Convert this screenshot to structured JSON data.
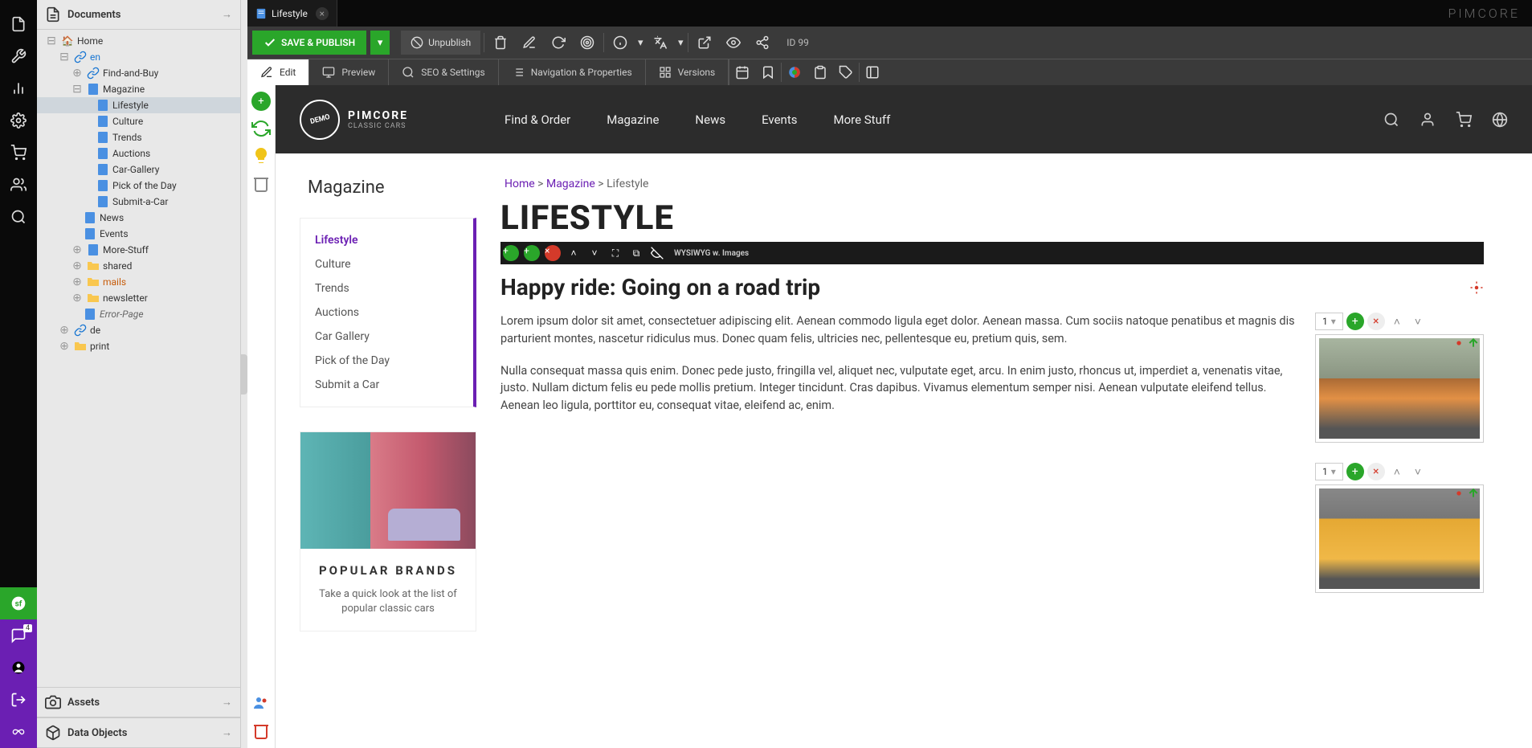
{
  "panels": {
    "documents": "Documents",
    "assets": "Assets",
    "data_objects": "Data Objects"
  },
  "tree": {
    "home": "Home",
    "en": "en",
    "find_and_buy": "Find-and-Buy",
    "magazine": "Magazine",
    "lifestyle": "Lifestyle",
    "culture": "Culture",
    "trends": "Trends",
    "auctions": "Auctions",
    "car_gallery": "Car-Gallery",
    "pick": "Pick of the Day",
    "submit": "Submit-a-Car",
    "news": "News",
    "events": "Events",
    "more_stuff": "More-Stuff",
    "shared": "shared",
    "mails": "mails",
    "newsletter": "newsletter",
    "error_page": "Error-Page",
    "de": "de",
    "print": "print"
  },
  "tab": {
    "title": "Lifestyle",
    "brand": "PIMCORE"
  },
  "toolbar": {
    "save": "SAVE & PUBLISH",
    "unpublish": "Unpublish",
    "id": "ID 99"
  },
  "toolbar2": {
    "edit": "Edit",
    "preview": "Preview",
    "seo": "SEO & Settings",
    "nav": "Navigation & Properties",
    "versions": "Versions"
  },
  "rail_badge": "4",
  "site": {
    "logo_demo": "DEMO",
    "logo_l1": "PIMCORE",
    "logo_l2": "CLASSIC CARS",
    "nav": {
      "find": "Find & Order",
      "magazine": "Magazine",
      "news": "News",
      "events": "Events",
      "more": "More Stuff"
    }
  },
  "page": {
    "mag_title": "Magazine",
    "nav": {
      "lifestyle": "Lifestyle",
      "culture": "Culture",
      "trends": "Trends",
      "auctions": "Auctions",
      "gallery": "Car Gallery",
      "pick": "Pick of the Day",
      "submit": "Submit a Car"
    },
    "popular": {
      "title": "POPULAR BRANDS",
      "desc": "Take a quick look at the list of popular classic cars"
    },
    "breadcrumb": {
      "home": "Home",
      "sep1": " > ",
      "magazine": "Magazine",
      "sep2": " > ",
      "current": "Lifestyle"
    },
    "h1": "LIFESTYLE",
    "block_label": "WYSIWYG w. Images",
    "h2": "Happy ride: Going on a road trip",
    "p1": "Lorem ipsum dolor sit amet, consectetuer adipiscing elit. Aenean commodo ligula eget dolor. Aenean massa. Cum sociis natoque penatibus et magnis dis parturient montes, nascetur ridiculus mus. Donec quam felis, ultricies nec, pellentesque eu, pretium quis, sem.",
    "p2": "Nulla consequat massa quis enim. Donec pede justo, fringilla vel, aliquet nec, vulputate eget, arcu. In enim justo, rhoncus ut, imperdiet a, venenatis vitae, justo. Nullam dictum felis eu pede mollis pretium. Integer tincidunt. Cras dapibus. Vivamus elementum semper nisi. Aenean vulputate eleifend tellus. Aenean leo ligula, porttitor eu, consequat vitae, eleifend ac, enim.",
    "img_num": "1"
  }
}
